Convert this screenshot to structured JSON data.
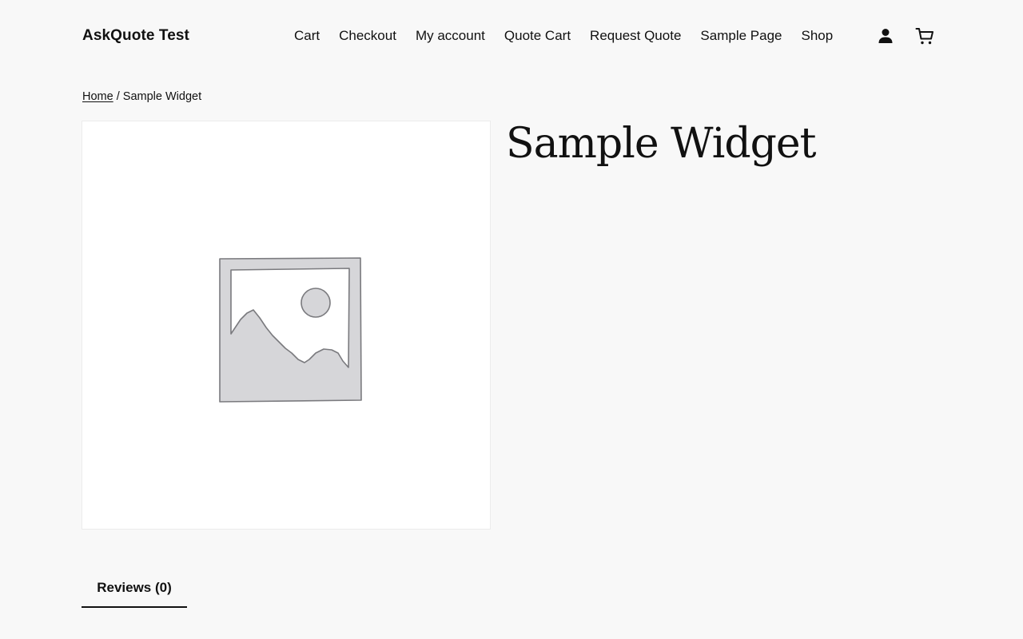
{
  "header": {
    "site_title": "AskQuote Test",
    "nav": [
      {
        "label": "Cart"
      },
      {
        "label": "Checkout"
      },
      {
        "label": "My account"
      },
      {
        "label": "Quote Cart"
      },
      {
        "label": "Request Quote"
      },
      {
        "label": "Sample Page"
      },
      {
        "label": "Shop"
      }
    ],
    "icons": {
      "account": "user-icon",
      "cart": "cart-icon"
    }
  },
  "breadcrumb": {
    "home": "Home",
    "separator": " / ",
    "current": "Sample Widget"
  },
  "product": {
    "title": "Sample Widget",
    "image": "placeholder-image-icon"
  },
  "tabs": [
    {
      "label": "Reviews (0)",
      "active": true
    }
  ],
  "colors": {
    "background": "#f8f8f8",
    "text": "#111111",
    "image_bg": "#ffffff"
  }
}
